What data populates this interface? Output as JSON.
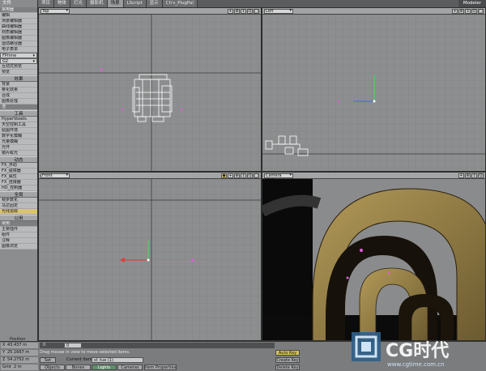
{
  "tabs": {
    "file": "文件",
    "items": [
      "项目",
      "物体",
      "灯光",
      "摄影机",
      "场景",
      "LScript",
      "显示",
      "Ch's_PlugPal"
    ],
    "active_index": 4,
    "modeler": "Modeler"
  },
  "sidebar": {
    "groups": [
      {
        "type": "dark",
        "label": "常用器"
      },
      {
        "type": "item",
        "label": "编辑"
      },
      {
        "type": "item",
        "label": "场景编辑器"
      },
      {
        "type": "item",
        "label": "曲线编辑器"
      },
      {
        "type": "item",
        "label": "材质编辑器"
      },
      {
        "type": "item",
        "label": "图像编辑器"
      },
      {
        "type": "item",
        "label": "运动路径器"
      },
      {
        "type": "item",
        "label": "电子表单"
      },
      {
        "type": "drop",
        "label": "FPrime"
      },
      {
        "type": "drop",
        "label": "G2"
      },
      {
        "type": "item",
        "label": "互动式预览"
      },
      {
        "type": "item",
        "label": "预览"
      },
      {
        "type": "head",
        "label": "效果"
      },
      {
        "type": "item",
        "label": "背景"
      },
      {
        "type": "item",
        "label": "雾化效果"
      },
      {
        "type": "item",
        "label": "合成"
      },
      {
        "type": "item",
        "label": "图像处理"
      },
      {
        "type": "dark",
        "label": "渲"
      },
      {
        "type": "head",
        "label": "工具"
      },
      {
        "type": "item",
        "label": "HyperVoxels"
      },
      {
        "type": "item",
        "label": "天空控制工具"
      },
      {
        "type": "item",
        "label": "贴图环境"
      },
      {
        "type": "item",
        "label": "数字化模糊"
      },
      {
        "type": "item",
        "label": "光量模糊"
      },
      {
        "type": "item",
        "label": "光环"
      },
      {
        "type": "item",
        "label": "镜片眩光"
      },
      {
        "type": "head",
        "label": "动态"
      },
      {
        "type": "item",
        "label": "FX_浮动"
      },
      {
        "type": "item",
        "label": "FX_碰撞器"
      },
      {
        "type": "item",
        "label": "FX_属性"
      },
      {
        "type": "item",
        "label": "FX_连接器"
      },
      {
        "type": "item",
        "label": "HD_控制器"
      },
      {
        "type": "head",
        "label": "全局"
      },
      {
        "type": "item",
        "label": "帧步数化"
      },
      {
        "type": "item",
        "label": "马达固定"
      },
      {
        "type": "sel",
        "label": "光线追踪"
      },
      {
        "type": "head",
        "label": "公用"
      },
      {
        "type": "dark",
        "label": "常用"
      },
      {
        "type": "item",
        "label": "主要插件"
      },
      {
        "type": "item",
        "label": "组件"
      },
      {
        "type": "item",
        "label": "注释"
      },
      {
        "type": "item",
        "label": "图像浏览"
      }
    ]
  },
  "viewports": {
    "top": {
      "label": "Top",
      "icons": [
        "+",
        "⊕",
        "↕",
        "Q",
        "□"
      ]
    },
    "left": {
      "label": "Left",
      "icons": [
        "+",
        "⊕",
        "↕",
        "Q",
        "□"
      ]
    },
    "front": {
      "label": "Front",
      "icons": [
        "◆",
        "+",
        "⊕",
        "↕",
        "Q",
        "□"
      ]
    },
    "camera": {
      "label": "Camera View",
      "icons": [
        "+",
        "⊕",
        "↕",
        "Q"
      ]
    }
  },
  "bottom": {
    "position_label": "Position",
    "x_axis": "X",
    "x_value": "43.437 m",
    "y_axis": "Y",
    "y_value": "25.1667 m",
    "z_axis": "Z",
    "z_value": "54.2752 m",
    "grid_label": "Grid",
    "grid_value": "2 m",
    "frame_start": "0",
    "frame_field": "0",
    "status_text": "Drag mouse in view to move selected items.",
    "set_label": "Set",
    "current_item_label": "Current Item",
    "current_item_value": "st_tue (1)",
    "tabs": [
      "Objects",
      "Bones",
      "Lights",
      "Cameras"
    ],
    "active_tab_index": 2,
    "item_props": "Item Properties",
    "auto_key": "Auto Key",
    "create_key": "Create Key",
    "delete_key": "Delete Key",
    "watermark": "CG时代",
    "watermark_url": "www.cgtime.com.cn"
  }
}
